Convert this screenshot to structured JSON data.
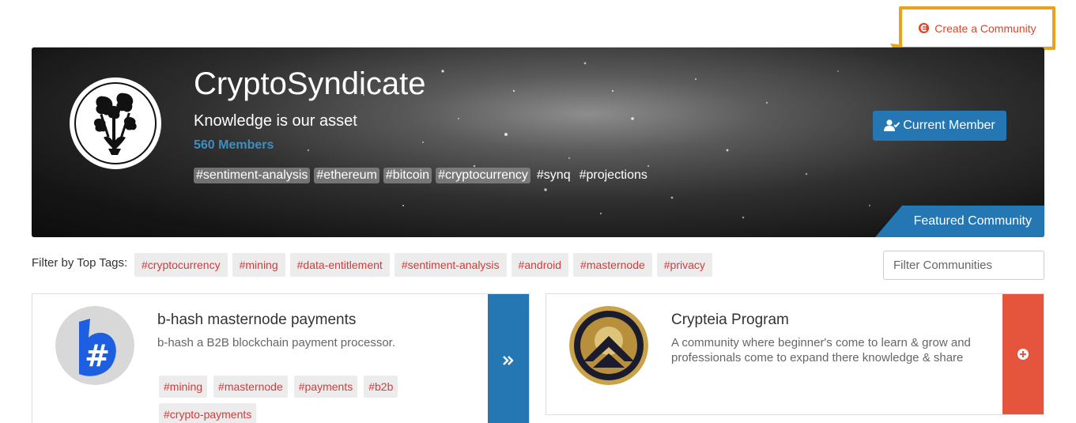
{
  "header": {
    "create_label": "Create a Community",
    "create_icon": "create-community-icon",
    "highlight_color": "#e8a21e"
  },
  "hero": {
    "title": "CryptoSyndicate",
    "tagline": "Knowledge is our asset",
    "members": "560 Members",
    "tags": [
      "#sentiment-analysis",
      "#ethereum",
      "#bitcoin",
      "#cryptocurrency",
      "#synq",
      "#projections"
    ],
    "member_button": "Current Member",
    "member_icon": "user-check-icon",
    "featured_label": "Featured Community",
    "accent_color": "#2477b3"
  },
  "filter": {
    "label": "Filter by Top Tags:",
    "tags": [
      "#cryptocurrency",
      "#mining",
      "#data-entitlement",
      "#sentiment-analysis",
      "#android",
      "#masternode",
      "#privacy"
    ],
    "search_placeholder": "Filter Communities"
  },
  "communities": [
    {
      "name": "b-hash masternode payments",
      "description": "b-hash a B2B blockchain payment processor.",
      "tags": [
        "#mining",
        "#masternode",
        "#payments",
        "#b2b",
        "#crypto-payments"
      ],
      "action_icon": "double-chevron-right-icon",
      "action_color": "#2477b3"
    },
    {
      "name": "Crypteia Program",
      "description": "A community where beginner's come to learn & grow and professionals come to expand there knowledge & share",
      "tags": [],
      "action_icon": "plus-circle-icon",
      "action_color": "#e5543c"
    }
  ]
}
